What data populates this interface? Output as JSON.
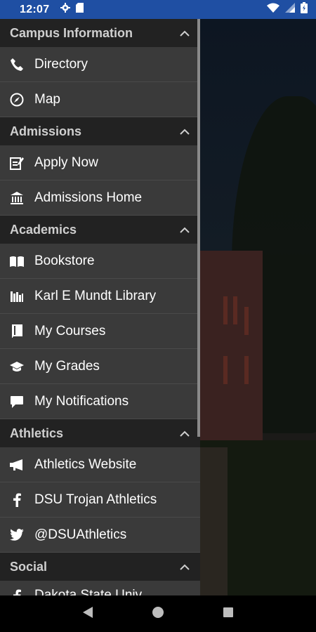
{
  "status_bar": {
    "time": "12:07"
  },
  "sections": [
    {
      "title": "Campus Information",
      "items": [
        {
          "label": "Directory",
          "icon": "phone-icon"
        },
        {
          "label": "Map",
          "icon": "compass-icon"
        }
      ]
    },
    {
      "title": "Admissions",
      "items": [
        {
          "label": "Apply Now",
          "icon": "edit-form-icon"
        },
        {
          "label": "Admissions Home",
          "icon": "institution-icon"
        }
      ]
    },
    {
      "title": "Academics",
      "items": [
        {
          "label": "Bookstore",
          "icon": "open-book-icon"
        },
        {
          "label": "Karl E Mundt Library",
          "icon": "library-icon"
        },
        {
          "label": "My Courses",
          "icon": "book-icon"
        },
        {
          "label": "My Grades",
          "icon": "graduation-cap-icon"
        },
        {
          "label": "My Notifications",
          "icon": "chat-bubble-icon"
        }
      ]
    },
    {
      "title": "Athletics",
      "items": [
        {
          "label": "Athletics Website",
          "icon": "megaphone-icon"
        },
        {
          "label": "DSU Trojan Athletics",
          "icon": "facebook-icon"
        },
        {
          "label": "@DSUAthletics",
          "icon": "twitter-icon"
        }
      ]
    },
    {
      "title": "Social",
      "items": [
        {
          "label": "Dakota State Univ",
          "icon": "facebook-icon"
        }
      ]
    }
  ]
}
